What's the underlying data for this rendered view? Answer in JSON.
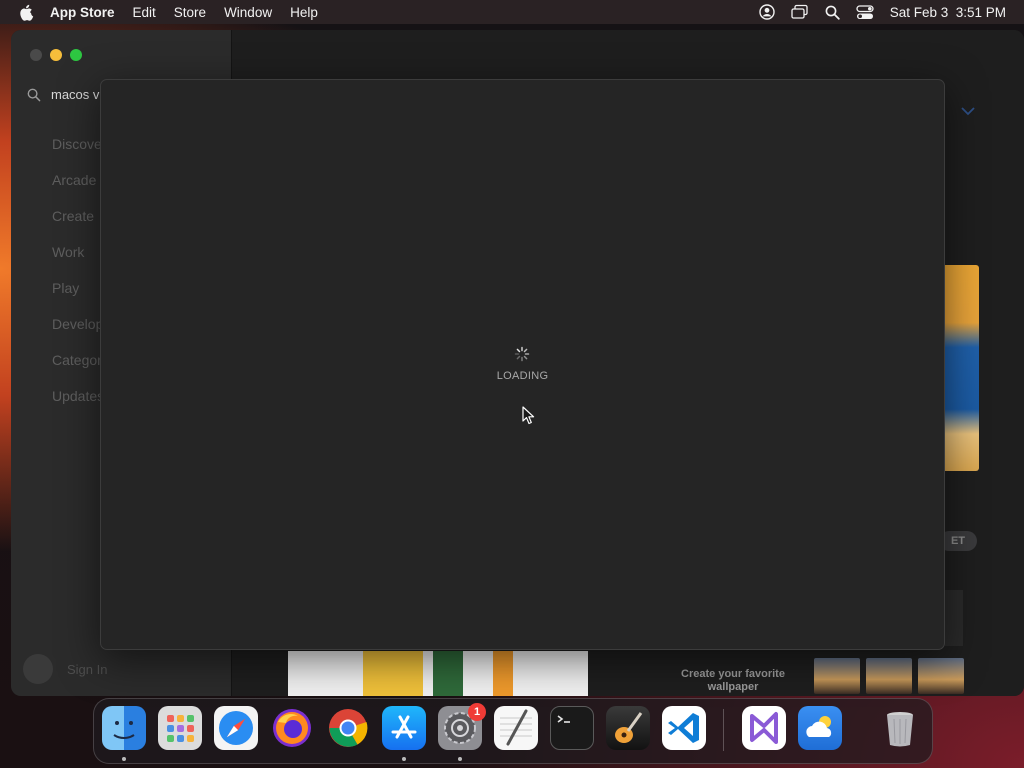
{
  "menubar": {
    "app_name": "App Store",
    "items": [
      "Edit",
      "Store",
      "Window",
      "Help"
    ],
    "clock": "Sat Feb 3  3:51 PM"
  },
  "sidebar": {
    "search_value": "macos v",
    "nav_items": [
      "Discover",
      "Arcade",
      "Create",
      "Work",
      "Play",
      "Develop",
      "Categories",
      "Updates"
    ],
    "sign_in": "Sign In"
  },
  "main": {
    "peek_get_label": "ET",
    "peek_caption": "Create your favorite wallpaper"
  },
  "sheet": {
    "status": "LOADING"
  },
  "dock": {
    "apps": [
      "Finder",
      "Launchpad",
      "Safari",
      "Firefox",
      "Google Chrome",
      "App Store",
      "System Settings",
      "TextEdit",
      "Terminal",
      "GarageBand",
      "Visual Studio Code",
      "Visual Studio",
      "Weather",
      "Trash"
    ],
    "settings_badge": "1"
  }
}
